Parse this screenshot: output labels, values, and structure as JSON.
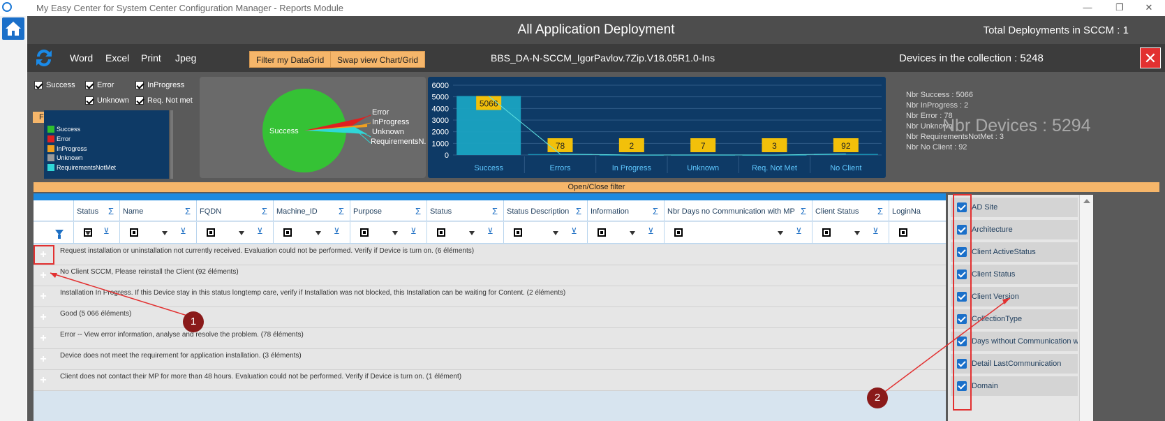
{
  "window": {
    "title": "My Easy Center for System Center Configuration Manager  -  Reports Module",
    "minimize": "—",
    "maximize": "❐",
    "close": "✕"
  },
  "header": {
    "title": "All Application Deployment",
    "total_deployments": "Total Deployments in SCCM : 1"
  },
  "toolbar": {
    "word": "Word",
    "excel": "Excel",
    "print": "Print",
    "jpeg": "Jpeg",
    "filter_datagrid": "Filter my DataGrid",
    "swap_view": "Swap view Chart/Grid",
    "collection_name": "BBS_DA-N-SCCM_IgorPavlov.7Zip.V18.05R1.0-Ins",
    "devices_in_collection": "Devices in the collection : 5248",
    "close_icon": "✕"
  },
  "filters": {
    "success": "Success",
    "error": "Error",
    "inprogress": "InProgress",
    "unknown": "Unknown",
    "req_not_met": "Req. Not met",
    "filter_status": "Filter status"
  },
  "legend": {
    "items": [
      {
        "label": "Success",
        "color": "#2fbf2f"
      },
      {
        "label": "Error",
        "color": "#e02020"
      },
      {
        "label": "InProgress",
        "color": "#f0a020"
      },
      {
        "label": "Unknown",
        "color": "#9a9a9a"
      },
      {
        "label": "RequirementsNotMet",
        "color": "#2fd8d8"
      }
    ]
  },
  "pie": {
    "center_label": "Success",
    "labels": [
      "Error",
      "InProgress",
      "Unknown",
      "RequirementsN..."
    ]
  },
  "chart_data": {
    "type": "bar",
    "categories": [
      "Success",
      "Errors",
      "In Progress",
      "Unknown",
      "Req. Not Met",
      "No Client"
    ],
    "values": [
      5066,
      78,
      2,
      7,
      3,
      92
    ],
    "data_labels": [
      "5066",
      "78",
      "2",
      "7",
      "3",
      "92"
    ],
    "yticks": [
      "6000",
      "5000",
      "4000",
      "3000",
      "2000",
      "1000",
      "0"
    ],
    "ylim": [
      0,
      6000
    ],
    "grid": true
  },
  "stats": {
    "success": "Nbr Success : 5066",
    "inprogress": "Nbr InProgress : 2",
    "error": "Nbr Error : 78",
    "unknown": "Nbr Unknown",
    "req_not_met": "Nbr RequirementsNotMet : 3",
    "no_client": "Nbr No Client : 92",
    "devices_total": "Nbr Devices : 5294"
  },
  "open_close_filter": "Open/Close filter",
  "grid": {
    "columns": [
      {
        "label": "Status",
        "sigma": "Σ"
      },
      {
        "label": "Name",
        "sigma": "Σ"
      },
      {
        "label": "FQDN",
        "sigma": "Σ"
      },
      {
        "label": "Machine_ID",
        "sigma": "Σ"
      },
      {
        "label": "Purpose",
        "sigma": "Σ"
      },
      {
        "label": "Status",
        "sigma": "Σ"
      },
      {
        "label": "Status Description",
        "sigma": "Σ"
      },
      {
        "label": "Information",
        "sigma": "Σ"
      },
      {
        "label": "Nbr Days no Communication with MP",
        "sigma": "Σ"
      },
      {
        "label": "Client Status",
        "sigma": "Σ"
      },
      {
        "label": "LoginNa",
        "sigma": ""
      }
    ],
    "groups": [
      "Request installation or uninstallation not currently received. Evaluation could not be performed. Verify if Device is turn on. (6 éléments)",
      "No Client SCCM, Please reinstall the Client (92 éléments)",
      "Installation In Progress. If this Device stay in this status longtemp care, verify if Installation was not blocked, this Installation can be waiting for Content. (2 éléments)",
      "Good (5 066 éléments)",
      "Error -- View error information, analyse and resolve the problem. (78 éléments)",
      "Device does not meet the requirement for application installation. (3 éléments)",
      "Client does not contact their MP for more than 48 hours. Evaluation could not be performed. Verify if Device is turn on. (1 élément)"
    ],
    "expand_symbol": "+"
  },
  "column_chooser": [
    "AD Site",
    "Architecture",
    "Client ActiveStatus",
    "Client Status",
    "Client Version",
    "CollectionType",
    "Days without Communication with MP",
    "Detail LastCommunication",
    "Domain"
  ],
  "annotations": {
    "one": "1",
    "two": "2"
  },
  "colors": {
    "accent_orange": "#f6b66a",
    "dark_blue": "#0e3a66",
    "bar_yellow": "#f2c00a",
    "success_green": "#2fbf2f",
    "highlight_red": "#e23030"
  }
}
